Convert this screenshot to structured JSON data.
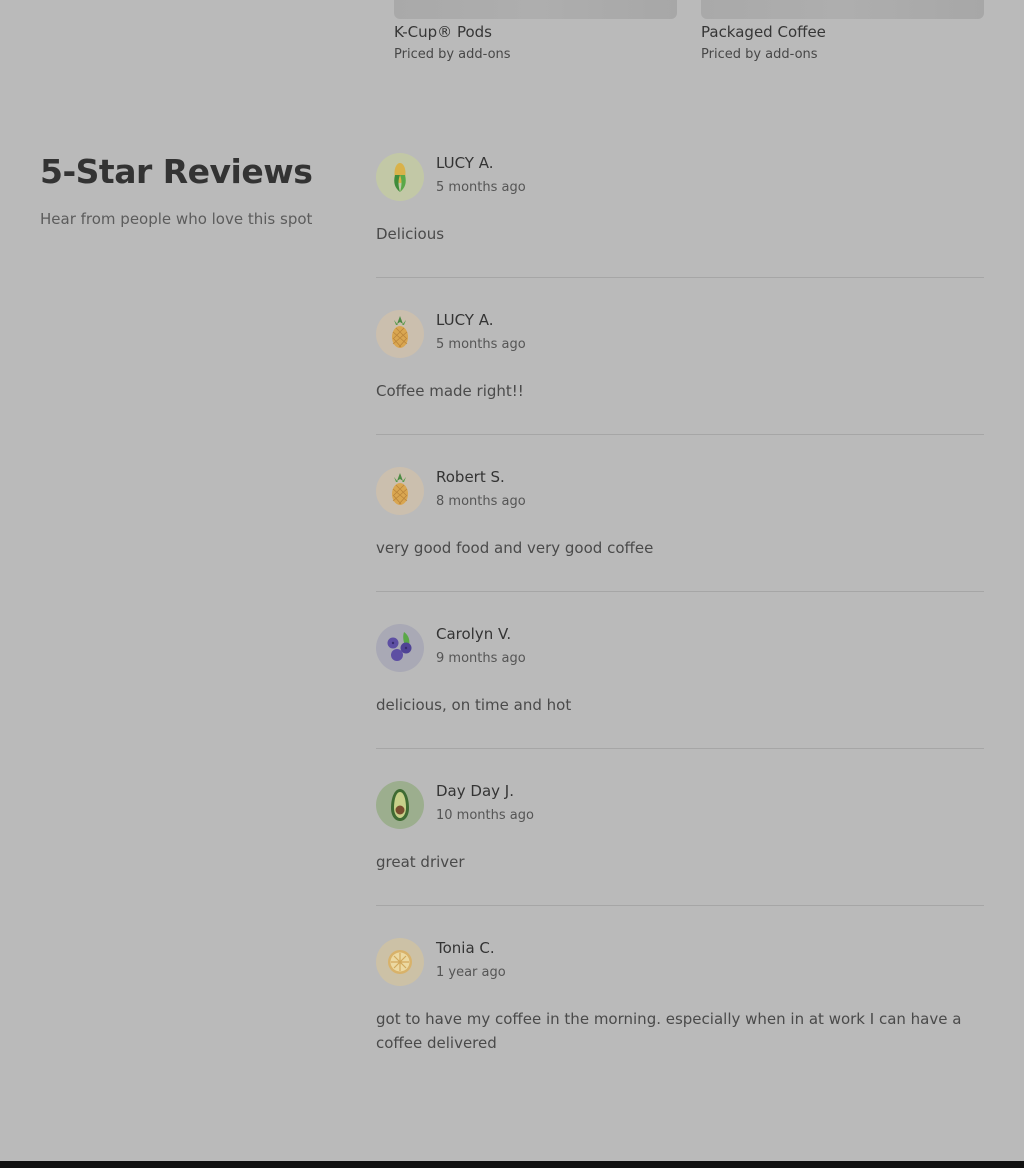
{
  "products": [
    {
      "name": "K-Cup® Pods",
      "price": "Priced by add-ons"
    },
    {
      "name": "Packaged Coffee",
      "price": "Priced by add-ons"
    }
  ],
  "reviews_section": {
    "title": "5-Star Reviews",
    "subtitle": "Hear from people who love this spot"
  },
  "reviews": [
    {
      "name": "LUCY A.",
      "time": "5 months ago",
      "text": "Delicious",
      "avatar_icon": "corn-icon"
    },
    {
      "name": "LUCY A.",
      "time": "5 months ago",
      "text": "Coffee made right!!",
      "avatar_icon": "pineapple-icon"
    },
    {
      "name": "Robert S.",
      "time": "8 months ago",
      "text": "very good food and very good coffee",
      "avatar_icon": "pineapple-icon"
    },
    {
      "name": "Carolyn V.",
      "time": "9 months ago",
      "text": "delicious, on time and hot",
      "avatar_icon": "blueberries-icon"
    },
    {
      "name": "Day Day J.",
      "time": "10 months ago",
      "text": "great driver",
      "avatar_icon": "avocado-icon"
    },
    {
      "name": "Tonia C.",
      "time": "1 year ago",
      "text": "got to have my coffee in the morning. especially when in at work I can have a coffee delivered",
      "avatar_icon": "lemon-icon"
    }
  ],
  "colors": {
    "corn_bg": "#c2c8a6",
    "pineapple_bg": "#cbbfae",
    "blueberries_bg": "#a9a9b5",
    "avocado_bg": "#9cae8e",
    "lemon_bg": "#ccc1a6"
  }
}
